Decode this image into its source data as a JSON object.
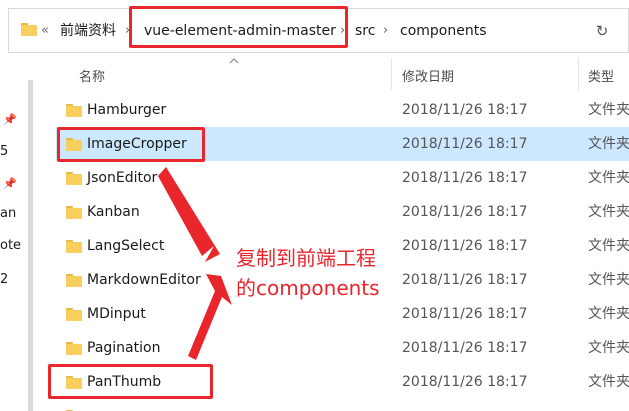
{
  "address_bar": {
    "overflow": "«",
    "crumbs": [
      "前端资料",
      "vue-element-admin-master",
      "src",
      "components"
    ],
    "separator": "›",
    "refresh_glyph": "↻"
  },
  "columns": {
    "name": "名称",
    "modified": "修改日期",
    "type": "类型"
  },
  "nav_pane": {
    "labels": [
      "5",
      "an",
      "ote",
      "2"
    ]
  },
  "rows": [
    {
      "name": "Hamburger",
      "date": "2018/11/26 18:17",
      "type": "文件夹"
    },
    {
      "name": "ImageCropper",
      "date": "2018/11/26 18:17",
      "type": "文件夹",
      "selected": true
    },
    {
      "name": "JsonEditor",
      "date": "2018/11/26 18:17",
      "type": "文件夹"
    },
    {
      "name": "Kanban",
      "date": "2018/11/26 18:17",
      "type": "文件夹"
    },
    {
      "name": "LangSelect",
      "date": "2018/11/26 18:17",
      "type": "文件夹"
    },
    {
      "name": "MarkdownEditor",
      "date": "2018/11/26 18:17",
      "type": "文件夹"
    },
    {
      "name": "MDinput",
      "date": "2018/11/26 18:17",
      "type": "文件夹"
    },
    {
      "name": "Pagination",
      "date": "2018/11/26 18:17",
      "type": "文件夹"
    },
    {
      "name": "PanThumb",
      "date": "2018/11/26 18:17",
      "type": "文件夹"
    }
  ],
  "annotation": {
    "line1": "复制到前端工程",
    "line2": "的components"
  },
  "colors": {
    "folder": "#f8cf5f",
    "selection": "#cce8ff",
    "annotation": "#e8262c"
  }
}
